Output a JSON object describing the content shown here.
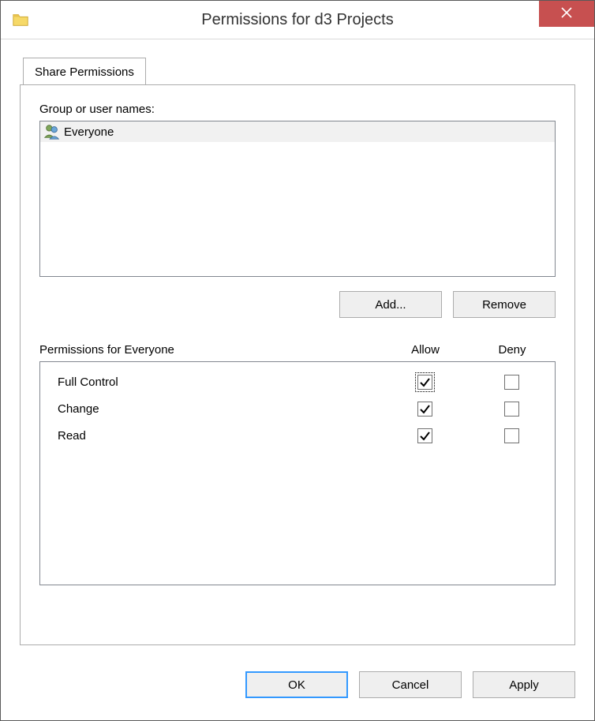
{
  "window": {
    "title": "Permissions for d3 Projects"
  },
  "tab": {
    "label": "Share Permissions"
  },
  "groups_section": {
    "label": "Group or user names:",
    "users": [
      {
        "name": "Everyone",
        "selected": true
      }
    ],
    "add_button": "Add...",
    "remove_button": "Remove"
  },
  "permissions_section": {
    "header_label": "Permissions for Everyone",
    "allow_label": "Allow",
    "deny_label": "Deny",
    "rows": [
      {
        "label": "Full Control",
        "allow": true,
        "deny": false,
        "focused": true
      },
      {
        "label": "Change",
        "allow": true,
        "deny": false,
        "focused": false
      },
      {
        "label": "Read",
        "allow": true,
        "deny": false,
        "focused": false
      }
    ]
  },
  "buttons": {
    "ok": "OK",
    "cancel": "Cancel",
    "apply": "Apply"
  }
}
